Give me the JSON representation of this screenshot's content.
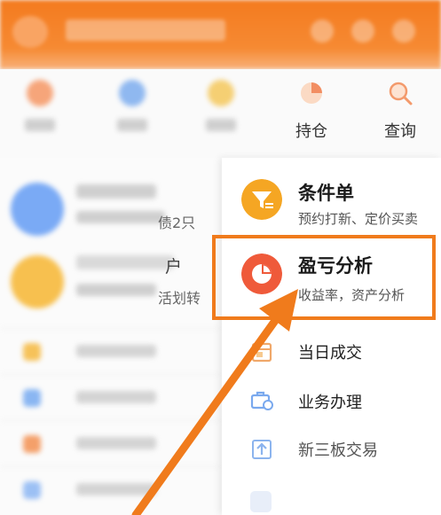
{
  "quickbar": {
    "items": [
      {
        "label": "持仓",
        "icon": "position-icon"
      },
      {
        "label": "查询",
        "icon": "search-icon"
      }
    ]
  },
  "left_peek": {
    "debt_text": "债2只",
    "account_text": "户",
    "transfer_text": "活划转"
  },
  "menu": {
    "condition_order": {
      "title": "条件单",
      "subtitle": "预约打新、定价买卖",
      "icon": "funnel-icon",
      "color": "#f5a623"
    },
    "profit_analysis": {
      "title": "盈亏分析",
      "subtitle": "收益率，资产分析",
      "icon": "pie-chart-icon",
      "color": "#ef5a3a"
    },
    "today_deals": {
      "label": "当日成交",
      "icon": "calendar-icon"
    },
    "business": {
      "label": "业务办理",
      "icon": "briefcase-icon"
    },
    "new_third_board": {
      "label": "新三板交易",
      "icon": "upload-icon"
    }
  },
  "colors": {
    "accent": "#f07b1c",
    "brand": "#f47b1f"
  }
}
